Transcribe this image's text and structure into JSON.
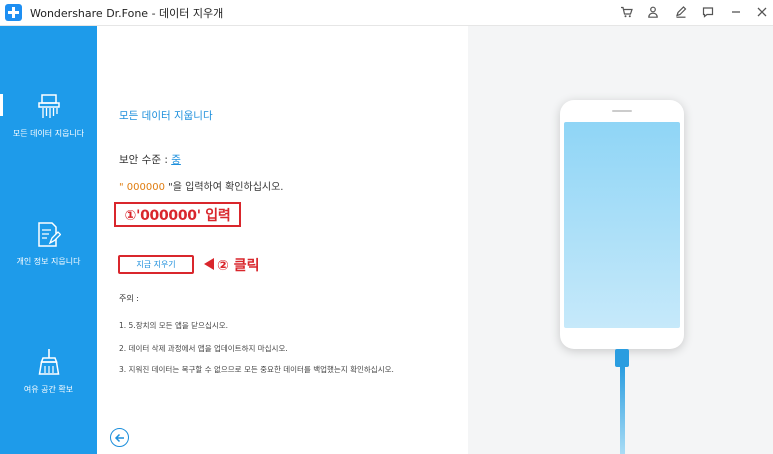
{
  "titlebar": {
    "app_name": "Wondershare Dr.Fone",
    "separator": " - ",
    "module": "데이터 지우개",
    "icons": [
      "cart-icon",
      "user-icon",
      "edit-icon",
      "feedback-icon",
      "minimize-icon",
      "close-icon"
    ]
  },
  "sidebar": {
    "items": [
      {
        "label": "모든 데이터 지웁니다",
        "icon": "shredder-icon",
        "active": true
      },
      {
        "label": "개인 정보 지웁니다",
        "icon": "document-edit-icon",
        "active": false
      },
      {
        "label": "여유 공간 확보",
        "icon": "broom-icon",
        "active": false
      }
    ]
  },
  "main": {
    "title": "모든 데이터 지웁니다",
    "security_label": "보안 수준 : ",
    "security_value": "중",
    "instruction_quote_open": "\" ",
    "instruction_code": "000000",
    "instruction_rest": " \"을 입력하여 확인하십시오.",
    "annotation_1": "①'000000' 입력",
    "erase_button": "지금 지우기",
    "annotation_2": "② 클릭",
    "notes_title": "주의 :",
    "notes": [
      "1. 5.장치의 모든 앱을 닫으십시오.",
      "2. 데이터 삭제 과정에서 앱을 업데이트하지 마십시오.",
      "3. 지워진 데이터는 복구할 수 없으므로 모든 중요한 데이터를 백업했는지 확인하십시오."
    ]
  },
  "colors": {
    "sidebar": "#1e9bea",
    "accent": "#1d8fdc",
    "annotation": "#d9262c",
    "code": "#e07d10"
  }
}
